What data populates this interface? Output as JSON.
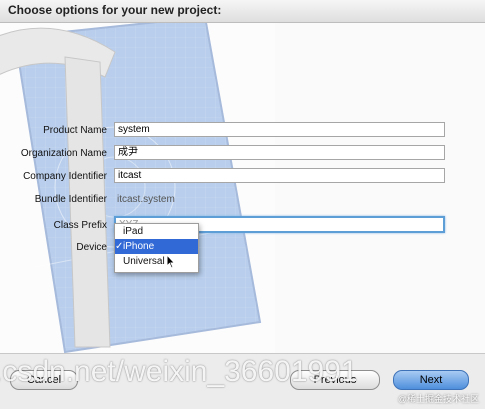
{
  "dialog": {
    "title": "Choose options for your new project:"
  },
  "form": {
    "product_name": {
      "label": "Product Name",
      "value": "system"
    },
    "organization_name": {
      "label": "Organization Name",
      "value": "成尹"
    },
    "company_identifier": {
      "label": "Company Identifier",
      "value": "itcast"
    },
    "bundle_identifier": {
      "label": "Bundle Identifier",
      "value": "itcast.system"
    },
    "class_prefix": {
      "label": "Class Prefix",
      "value": "XYZ"
    },
    "device": {
      "label": "Device",
      "options": [
        "iPad",
        "iPhone",
        "Universal"
      ],
      "selected": "iPhone",
      "check": "✓"
    }
  },
  "buttons": {
    "cancel": "Cancel",
    "previous": "Previous",
    "next": "Next"
  },
  "watermark": {
    "text": ".csdn.net/weixin_36601991",
    "juejin": "@稀土掘金技术社区"
  },
  "colors": {
    "selection": "#3169d6",
    "focus_ring": "#5e9ed6",
    "art_blue": "#7fa6dd"
  }
}
